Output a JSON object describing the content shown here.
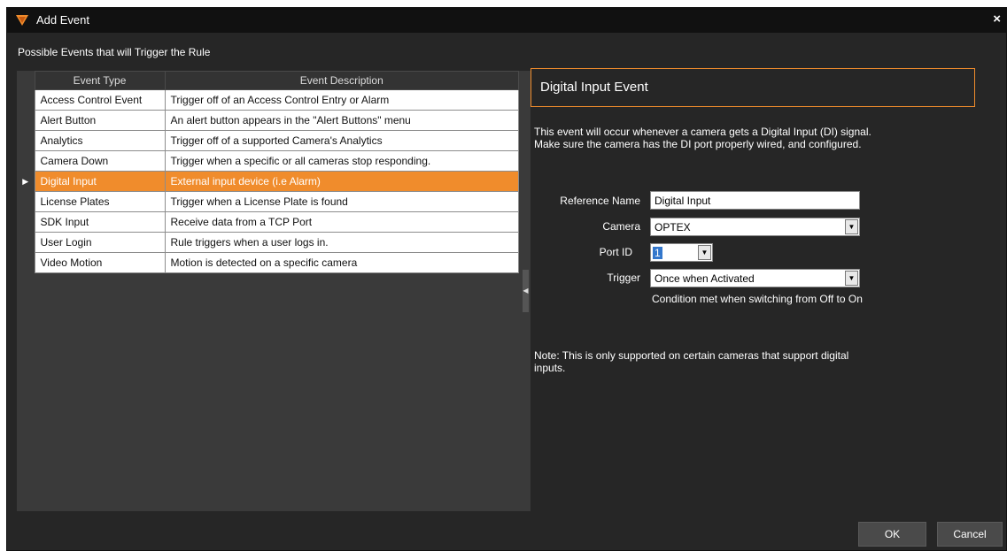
{
  "window": {
    "title": "Add Event",
    "close_glyph": "×",
    "icon": "orange-shield-icon"
  },
  "section_label": "Possible Events that will Trigger the Rule",
  "table": {
    "columns": [
      "Event Type",
      "Event Description"
    ],
    "selected_index": 4,
    "selected_marker": "▶",
    "rows": [
      {
        "type": "Access Control Event",
        "description": "Trigger off of an Access Control Entry or Alarm"
      },
      {
        "type": "Alert Button",
        "description": "An alert button appears in the \"Alert Buttons\" menu"
      },
      {
        "type": "Analytics",
        "description": "Trigger off of a supported Camera's Analytics"
      },
      {
        "type": "Camera Down",
        "description": "Trigger when a specific or all cameras stop responding."
      },
      {
        "type": "Digital Input",
        "description": "External input device (i.e Alarm)"
      },
      {
        "type": "License Plates",
        "description": "Trigger when a License Plate is found"
      },
      {
        "type": "SDK Input",
        "description": "Receive data from a TCP Port"
      },
      {
        "type": "User Login",
        "description": "Rule triggers when a user logs in."
      },
      {
        "type": "Video Motion",
        "description": "Motion is detected on a specific camera"
      }
    ]
  },
  "detail": {
    "header": "Digital Input Event",
    "description_line1": "This event will occur whenever a camera gets a Digital Input (DI) signal.",
    "description_line2": "Make sure the camera has the DI port properly wired, and configured.",
    "form": {
      "reference_name_label": "Reference Name",
      "reference_name_value": "Digital Input",
      "camera_label": "Camera",
      "camera_value": "OPTEX",
      "port_id_label": "Port ID",
      "port_id_value": "1",
      "trigger_label": "Trigger",
      "trigger_value": "Once when Activated",
      "trigger_hint": "Condition met when switching from Off to On"
    },
    "note_line1": "Note: This is only supported on certain cameras that support digital",
    "note_line2": "inputs."
  },
  "buttons": {
    "ok": "OK",
    "cancel": "Cancel"
  },
  "colors": {
    "accent": "#f08c2c",
    "background": "#262626",
    "panel": "#3a3a3a"
  }
}
